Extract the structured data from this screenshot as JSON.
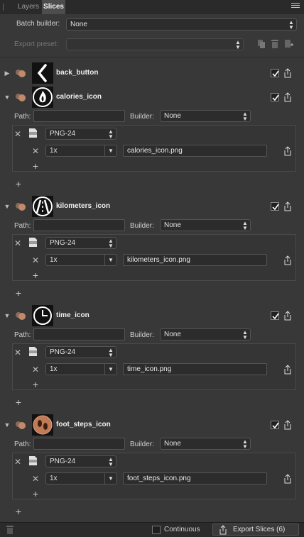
{
  "tabs": [
    {
      "label": "Layers"
    },
    {
      "label": "Slices"
    }
  ],
  "batch_builder": {
    "label": "Batch builder:",
    "value": "None"
  },
  "export_preset": {
    "label": "Export preset:",
    "value": ""
  },
  "field_labels": {
    "path": "Path:",
    "builder": "Builder:"
  },
  "slices": [
    {
      "name": "back_button",
      "expanded": false,
      "icon": "chevron-left-icon",
      "checked": true
    },
    {
      "name": "calories_icon",
      "expanded": true,
      "icon": "flame-icon",
      "checked": true,
      "path": "",
      "builder": "None",
      "format": "PNG-24",
      "scale": "1x",
      "filename": "calories_icon.png"
    },
    {
      "name": "kilometers_icon",
      "expanded": true,
      "icon": "road-icon",
      "checked": true,
      "path": "",
      "builder": "None",
      "format": "PNG-24",
      "scale": "1x",
      "filename": "kilometers_icon.png"
    },
    {
      "name": "time_icon",
      "expanded": true,
      "icon": "clock-icon",
      "checked": true,
      "path": "",
      "builder": "None",
      "format": "PNG-24",
      "scale": "1x",
      "filename": "time_icon.png"
    },
    {
      "name": "foot_steps_icon",
      "expanded": true,
      "icon": "footprints-icon",
      "checked": true,
      "path": "",
      "builder": "None",
      "format": "PNG-24",
      "scale": "1x",
      "filename": "foot_steps_icon.png"
    }
  ],
  "footer": {
    "continuous_label": "Continuous",
    "export_label": "Export Slices (6)",
    "continuous_checked": false
  },
  "colors": {
    "panel": "#383838",
    "field": "#2c2c2c",
    "footsteps_badge": "#c07a55"
  }
}
